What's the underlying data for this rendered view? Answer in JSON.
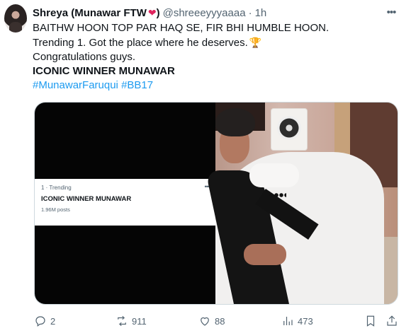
{
  "post": {
    "author_name": "Shreya (Munawar FTW",
    "author_name_close": ")",
    "handle": "@shreeeyyyaaaa",
    "separator": "·",
    "time": "1h",
    "more_icon": "•••",
    "lines": [
      "BAITHW HOON TOP PAR HAQ SE, FIR BHI HUMBLE HOON.",
      "Trending 1. Got the place where he deserves.",
      "Congratulations guys."
    ],
    "bold_line": "ICONIC WINNER MUNAWAR",
    "hashtags": [
      "#MunawarFaruqui",
      "#BB17"
    ]
  },
  "media": {
    "trend_card": {
      "meta": "1 · Trending",
      "title": "ICONIC WINNER MUNAWAR",
      "posts": "1.96M posts",
      "more_icon": "•••"
    }
  },
  "actions": {
    "reply_count": "2",
    "repost_count": "911",
    "like_count": "88",
    "views_count": "473"
  },
  "icons": {
    "heart_emoji": "heart-icon",
    "trophy_emoji": "trophy-icon",
    "reply": "reply-icon",
    "repost": "repost-icon",
    "like": "like-icon",
    "views": "views-icon",
    "bookmark": "bookmark-icon",
    "share": "share-icon"
  },
  "colors": {
    "link": "#1d9bf0",
    "secondary_text": "#536471",
    "heart": "#e0245e"
  }
}
